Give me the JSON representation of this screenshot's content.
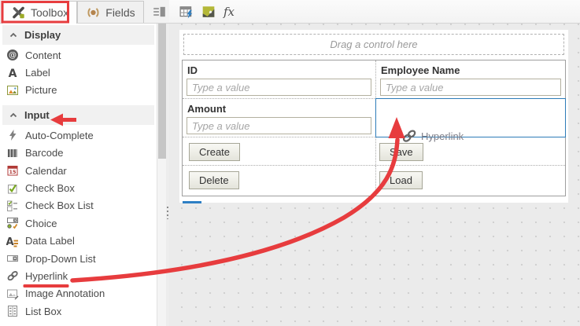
{
  "tabs": [
    {
      "id": "toolbox",
      "label": "Toolbox",
      "icon": "tools-icon"
    },
    {
      "id": "fields",
      "label": "Fields",
      "icon": "fields-icon"
    },
    {
      "id": "collapse",
      "label": "",
      "icon": "collapse-panel-icon"
    }
  ],
  "toolbar": {
    "items": [
      {
        "icon": "data-table-icon"
      },
      {
        "icon": "theme-icon"
      }
    ],
    "formula_label": "fx"
  },
  "sidebar": {
    "sections": [
      {
        "label": "Display",
        "items": [
          {
            "icon": "content-icon",
            "label": "Content"
          },
          {
            "icon": "label-icon",
            "label": "Label"
          },
          {
            "icon": "picture-icon",
            "label": "Picture"
          }
        ]
      },
      {
        "label": "Input",
        "items": [
          {
            "icon": "auto-complete-icon",
            "label": "Auto-Complete"
          },
          {
            "icon": "barcode-icon",
            "label": "Barcode"
          },
          {
            "icon": "calendar-icon",
            "label": "Calendar"
          },
          {
            "icon": "check-box-icon",
            "label": "Check Box"
          },
          {
            "icon": "check-box-list-icon",
            "label": "Check Box List"
          },
          {
            "icon": "choice-icon",
            "label": "Choice"
          },
          {
            "icon": "data-label-icon",
            "label": "Data Label"
          },
          {
            "icon": "drop-down-list-icon",
            "label": "Drop-Down List"
          },
          {
            "icon": "hyperlink-icon",
            "label": "Hyperlink"
          },
          {
            "icon": "image-annotation-icon",
            "label": "Image Annotation"
          },
          {
            "icon": "list-box-icon",
            "label": "List Box"
          }
        ]
      }
    ]
  },
  "canvas": {
    "drop_zone_text": "Drag a control here",
    "fields": [
      {
        "label": "ID",
        "placeholder": "Type a value"
      },
      {
        "label": "Employee Name",
        "placeholder": "Type a value"
      },
      {
        "label": "Amount",
        "placeholder": "Type a value"
      }
    ],
    "buttons": [
      "Create",
      "Save",
      "Delete",
      "Load"
    ],
    "drag_ghost": {
      "icon": "hyperlink-icon",
      "label": "Hyperlink"
    }
  },
  "colors": {
    "annotation_red": "#e73c3e",
    "drop_target_blue": "#2d7cb8",
    "canvas_background": "#ebebeb"
  }
}
